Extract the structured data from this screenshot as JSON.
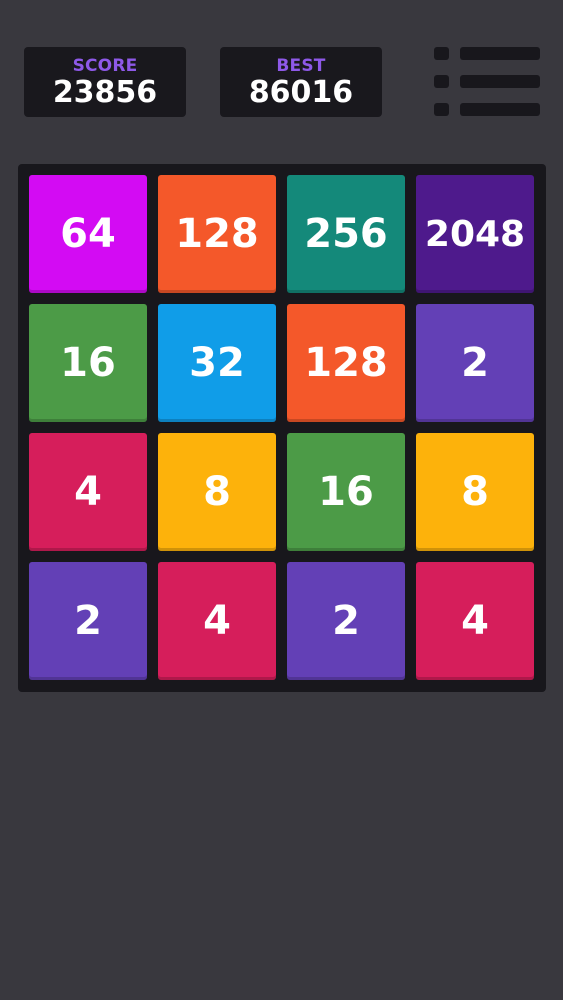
{
  "header": {
    "score": {
      "label": "SCORE",
      "value": "23856"
    },
    "best": {
      "label": "BEST",
      "value": "86016"
    },
    "menu_icon": "list-menu-icon"
  },
  "board": {
    "size": 4,
    "tiles": [
      {
        "value": "64",
        "color": "#d30bf3"
      },
      {
        "value": "128",
        "color": "#f4582a"
      },
      {
        "value": "256",
        "color": "#14897a"
      },
      {
        "value": "2048",
        "color": "#4e1a8c"
      },
      {
        "value": "16",
        "color": "#4c9b47"
      },
      {
        "value": "32",
        "color": "#109de8"
      },
      {
        "value": "128",
        "color": "#f4582a"
      },
      {
        "value": "2",
        "color": "#6340b6"
      },
      {
        "value": "4",
        "color": "#d61e5b"
      },
      {
        "value": "8",
        "color": "#fdb20b"
      },
      {
        "value": "16",
        "color": "#4c9b47"
      },
      {
        "value": "8",
        "color": "#fdb20b"
      },
      {
        "value": "2",
        "color": "#6340b6"
      },
      {
        "value": "4",
        "color": "#d61e5b"
      },
      {
        "value": "2",
        "color": "#6340b6"
      },
      {
        "value": "4",
        "color": "#d61e5b"
      }
    ]
  },
  "colors": {
    "background": "#39383e",
    "panel": "#19181d",
    "label_accent": "#8e59e8"
  }
}
